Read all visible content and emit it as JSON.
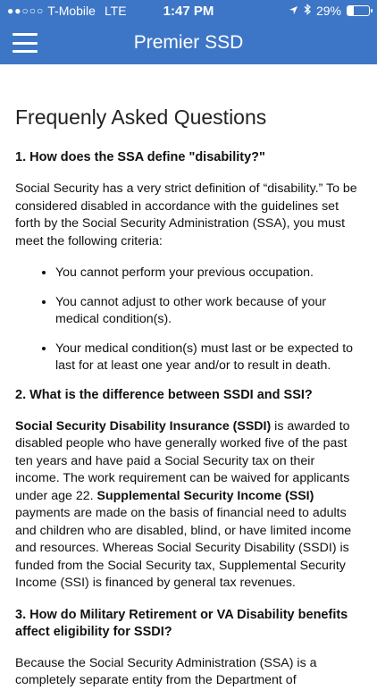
{
  "status_bar": {
    "signal": "●●○○○",
    "carrier": "T-Mobile",
    "network": "LTE",
    "time": "1:47 PM",
    "battery": "29%",
    "battery_level": 0.29
  },
  "navbar": {
    "title": "Premier SSD"
  },
  "page": {
    "title": "Frequenly Asked Questions"
  },
  "faq": {
    "q1": {
      "question": "1. How does the SSA define \"disability?\"",
      "answer": "Social Security has a very strict definition of “disability.” To be considered disabled in accordance with the guidelines set forth by the Social Security Administration (SSA), you must meet the following criteria:",
      "bullets": [
        "You cannot perform your previous occupation.",
        "You cannot adjust to other work because of your medical condition(s).",
        "Your medical condition(s) must last or be expected to last for at least one year and/or to result in death."
      ]
    },
    "q2": {
      "question": "2. What is the difference between SSDI and SSI?",
      "ssdi_term": "Social Security Disability Insurance (SSDI)",
      "ssdi_text": " is awarded to disabled people who have generally worked five of the past ten years and have paid a Social Security tax on their income. The work requirement can be waived for applicants under age 22. ",
      "ssi_term": "Supplemental Security Income (SSI)",
      "ssi_text": " payments are made on the basis of financial need to adults and children who are disabled, blind, or have limited income and resources. Whereas Social Security Disability (SSDI) is funded from the Social Security tax, Supplemental Security Income (SSI) is financed by general tax revenues."
    },
    "q3": {
      "question": "3. How do Military Retirement or VA Disability benefits affect eligibility for SSDI?",
      "answer": "Because the Social Security Administration (SSA) is a completely separate entity from the Department of"
    }
  }
}
